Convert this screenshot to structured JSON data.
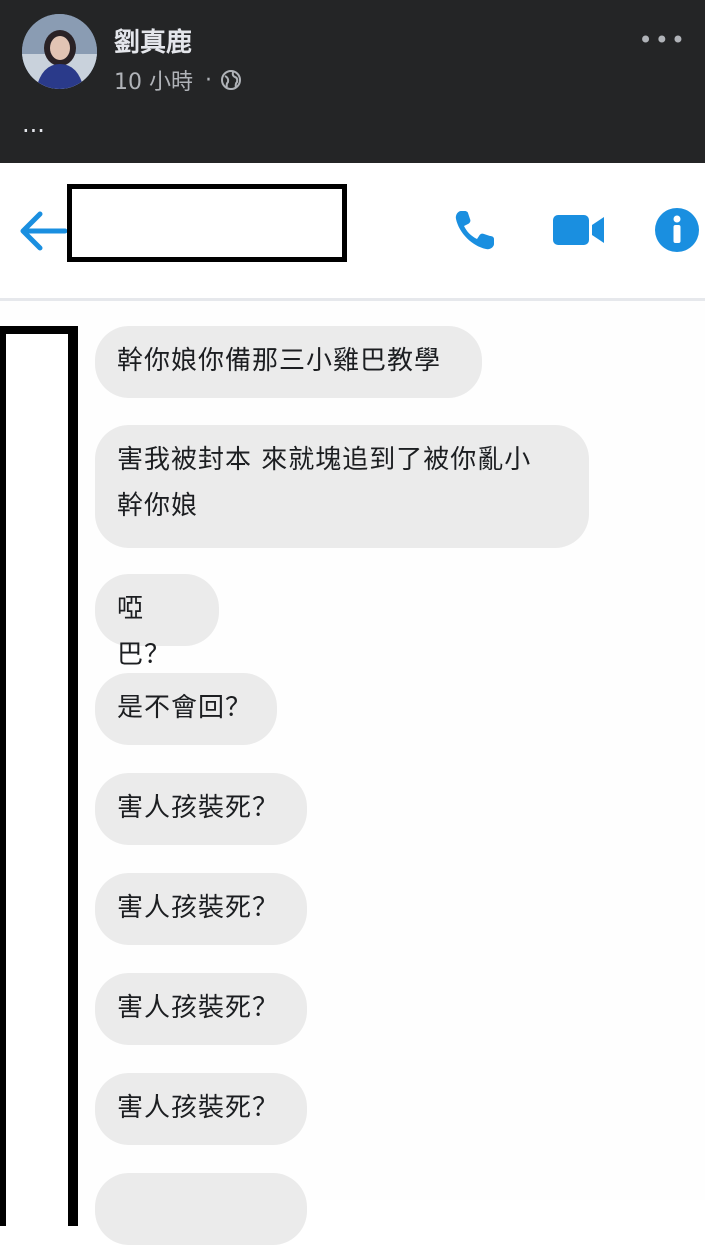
{
  "post": {
    "author_name": "劉真鹿",
    "time": "10 小時",
    "separator": "·",
    "privacy_icon": "globe-icon",
    "more_icon": "more-options-icon",
    "more_label": "•••",
    "text": "..."
  },
  "screenshot": {
    "topbar": {
      "back_icon": "back-arrow-icon",
      "call_icon": "phone-icon",
      "video_icon": "video-camera-icon",
      "info_icon": "info-icon"
    },
    "messages": [
      "幹你娘你備那三小雞巴教學",
      "害我被封本 來就塊追到了被你亂小",
      "幹你娘",
      "啞巴？",
      "是不會回？",
      "害人孩裝死？",
      "害人孩裝死？",
      "害人孩裝死？",
      "害人孩裝死？"
    ]
  },
  "colors": {
    "header_bg": "#242526",
    "accent_blue": "#1a8fe0",
    "bubble_bg": "#ebebeb"
  }
}
